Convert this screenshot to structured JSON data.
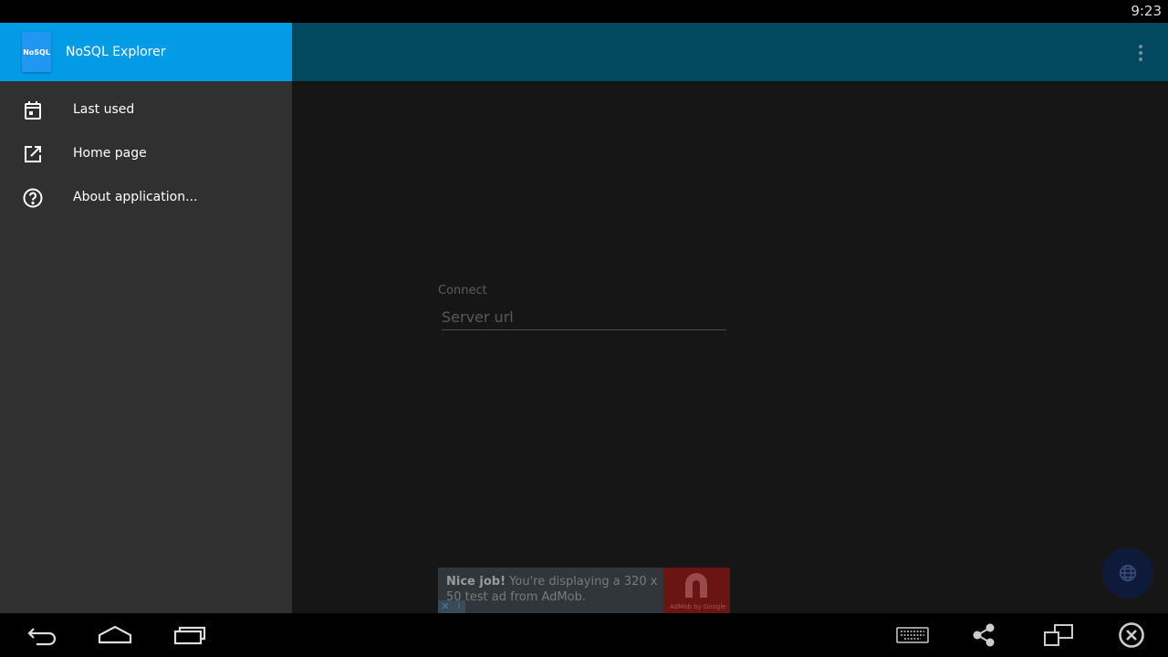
{
  "status_bar": {
    "time": "9:23"
  },
  "drawer": {
    "app_logo_text": "NoSQL",
    "app_title": "NoSQL Explorer",
    "items": [
      {
        "label": "Last used",
        "icon": "calendar-icon"
      },
      {
        "label": "Home page",
        "icon": "open-external-icon"
      },
      {
        "label": "About application...",
        "icon": "help-circle-icon"
      }
    ]
  },
  "main": {
    "connect_label": "Connect",
    "server_url_placeholder": "Server url"
  },
  "ad": {
    "bold": "Nice job!",
    "text": "You're displaying a 320 x 50 test ad from AdMob.",
    "logo_sub": "AdMob by Google"
  },
  "colors": {
    "toolbar": "#02485f",
    "drawer_header": "#039be5",
    "drawer_bg": "#303030",
    "content_bg": "#161616",
    "fab": "#0f1a3a"
  }
}
